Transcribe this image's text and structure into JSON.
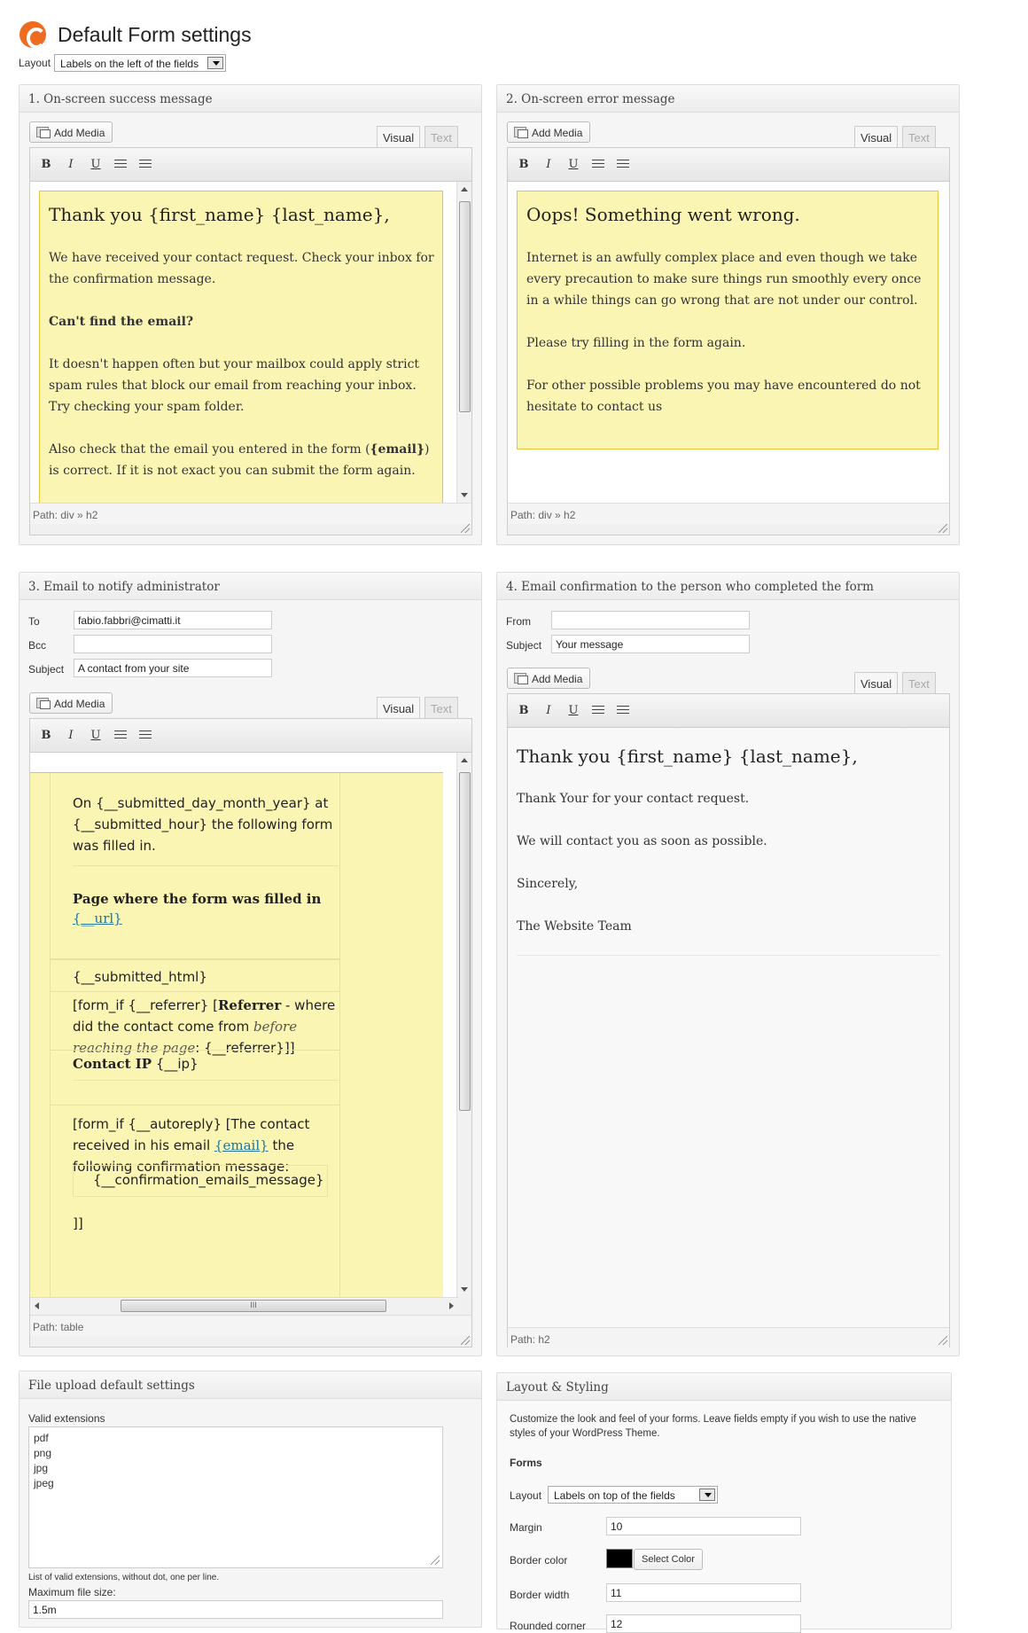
{
  "header": {
    "title": "Default Form settings",
    "layout_label": "Layout",
    "layout_value": "Labels on the left of the fields"
  },
  "panel1": {
    "title": "1. On-screen success message",
    "add_media": "Add Media",
    "tab_visual": "Visual",
    "tab_text": "Text",
    "heading": "Thank you {first_name} {last_name},",
    "p1": "We have received your contact request. Check your inbox for the confirmation message.",
    "p2": "Can't find the email?",
    "p3": "It doesn't happen often but your mailbox could apply strict spam rules that block our email from reaching your inbox. Try checking your spam folder.",
    "p4_a": "Also check that the email you entered in the form (",
    "p4_b": "{email}",
    "p4_c": ") is correct. If it is not exact you can submit the form again.",
    "path": "Path: div » h2"
  },
  "panel2": {
    "title": "2. On-screen error message",
    "add_media": "Add Media",
    "tab_visual": "Visual",
    "tab_text": "Text",
    "heading": "Oops! Something went wrong.",
    "p1": "Internet is an awfully complex place and even though we take every precaution to make sure things run smoothly every once in a while things can go wrong that are not under our control.",
    "p2": "Please try filling in the form again.",
    "p3": "For other possible problems you may have encountered do not hesitate to contact us",
    "path": "Path: div » h2"
  },
  "panel3": {
    "title": "3. Email to notify administrator",
    "to_label": "To",
    "to_value": "fabio.fabbri@cimatti.it",
    "bcc_label": "Bcc",
    "bcc_value": "",
    "subject_label": "Subject",
    "subject_value": "A contact from your site",
    "add_media": "Add Media",
    "tab_visual": "Visual",
    "tab_text": "Text",
    "r1": "On {__submitted_day_month_year} at {__submitted_hour} the following form was filled in.",
    "r2_bold": "Page where the form was filled in",
    "r2_link": "{__url}",
    "r3": "{__submitted_html}",
    "r4_a": "[form_if {__referrer} [",
    "r4_bold": "Referrer",
    "r4_b": " - where did the contact come from ",
    "r4_italic": "before reaching the page",
    "r4_c": ": {__referrer}]]",
    "r5_bold": "Contact IP",
    "r5_text": " {__ip}",
    "r6_a": "[form_if {__autoreply} [The contact received in his email ",
    "r6_link": "{email}",
    "r6_b": " the following confirmation message:",
    "r6_inner": "{__confirmation_emails_message}",
    "r6_end": "]]",
    "hscroll_grip": "III",
    "path": "Path: table"
  },
  "panel4": {
    "title": "4. Email confirmation to the person who completed the form",
    "from_label": "From",
    "from_value": "",
    "subject_label": "Subject",
    "subject_value": "Your message",
    "add_media": "Add Media",
    "tab_visual": "Visual",
    "tab_text": "Text",
    "heading": "Thank you {first_name} {last_name},",
    "p1": "Thank Your for your contact request.",
    "p2": "We will contact you as soon as possible.",
    "p3": "Sincerely,",
    "p4": "The Website Team",
    "path": "Path: h2"
  },
  "upload": {
    "title": "File upload default settings",
    "ext_label": "Valid extensions",
    "extensions": [
      "pdf",
      "png",
      "jpg",
      "jpeg"
    ],
    "hint": "List of valid extensions, without dot, one per line.",
    "max_label": "Maximum file size:",
    "max_value": "1.5m"
  },
  "styling": {
    "title": "Layout & Styling",
    "desc": "Customize the look and feel of your forms. Leave fields empty if you wish to use the native styles of your WordPress Theme.",
    "forms_heading": "Forms",
    "layout_label": "Layout",
    "layout_value": "Labels on top of the fields",
    "margin_label": "Margin",
    "margin_value": "10",
    "border_color_label": "Border color",
    "border_color_value": "#000000",
    "select_color": "Select Color",
    "border_width_label": "Border width",
    "border_width_value": "11",
    "rounded_label": "Rounded corner",
    "rounded_value": "12"
  }
}
